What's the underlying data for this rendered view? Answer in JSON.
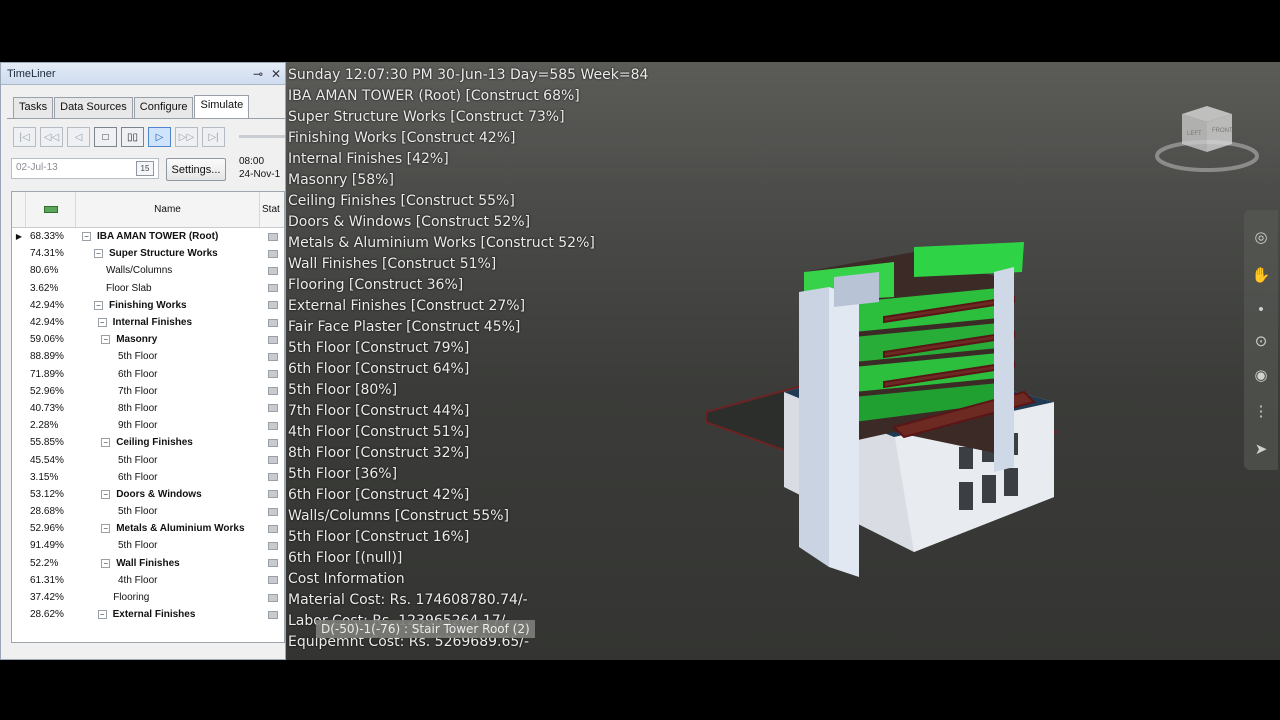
{
  "timeliner": {
    "title": "TimeLiner",
    "pin_icon": "pin-icon",
    "close_icon": "close-icon",
    "tabs": [
      "Tasks",
      "Data Sources",
      "Configure",
      "Simulate"
    ],
    "active_tab": "Simulate",
    "date_value": "02-Jul-13",
    "calendar_label": "15",
    "settings_label": "Settings...",
    "time_start": "08:00",
    "time_end": "24-Nov-1",
    "columns": {
      "name": "Name",
      "status": "Stat"
    },
    "rows": [
      {
        "pct": "68.33%",
        "name": "IBA AMAN TOWER (Root)",
        "bold": true,
        "toggle": "⊟",
        "level": 0,
        "current": true
      },
      {
        "pct": "74.31%",
        "name": "Super Structure Works",
        "bold": true,
        "toggle": "⊟",
        "level": 1
      },
      {
        "pct": "80.6%",
        "name": "Walls/Columns",
        "bold": false,
        "toggle": "",
        "level": 2
      },
      {
        "pct": "3.62%",
        "name": "Floor Slab",
        "bold": false,
        "toggle": "",
        "level": 2
      },
      {
        "pct": "42.94%",
        "name": "Finishing Works",
        "bold": true,
        "toggle": "⊟",
        "level": 1
      },
      {
        "pct": "42.94%",
        "name": "Internal Finishes",
        "bold": true,
        "toggle": "⊟",
        "level": 1.3
      },
      {
        "pct": "59.06%",
        "name": "Masonry",
        "bold": true,
        "toggle": "⊟",
        "level": 1.6
      },
      {
        "pct": "88.89%",
        "name": "5th Floor",
        "bold": false,
        "toggle": "",
        "level": 3
      },
      {
        "pct": "71.89%",
        "name": "6th Floor",
        "bold": false,
        "toggle": "",
        "level": 3
      },
      {
        "pct": "52.96%",
        "name": "7th Floor",
        "bold": false,
        "toggle": "",
        "level": 3
      },
      {
        "pct": "40.73%",
        "name": "8th Floor",
        "bold": false,
        "toggle": "",
        "level": 3
      },
      {
        "pct": "2.28%",
        "name": "9th Floor",
        "bold": false,
        "toggle": "",
        "level": 3
      },
      {
        "pct": "55.85%",
        "name": "Ceiling Finishes",
        "bold": true,
        "toggle": "⊟",
        "level": 1.6
      },
      {
        "pct": "45.54%",
        "name": "5th Floor",
        "bold": false,
        "toggle": "",
        "level": 3
      },
      {
        "pct": "3.15%",
        "name": "6th Floor",
        "bold": false,
        "toggle": "",
        "level": 3
      },
      {
        "pct": "53.12%",
        "name": "Doors & Windows",
        "bold": true,
        "toggle": "⊟",
        "level": 1.6
      },
      {
        "pct": "28.68%",
        "name": "5th Floor",
        "bold": false,
        "toggle": "",
        "level": 3
      },
      {
        "pct": "52.96%",
        "name": "Metals & Aluminium Works",
        "bold": true,
        "toggle": "⊟",
        "level": 1.6
      },
      {
        "pct": "91.49%",
        "name": "5th Floor",
        "bold": false,
        "toggle": "",
        "level": 3
      },
      {
        "pct": "52.2%",
        "name": "Wall Finishes",
        "bold": true,
        "toggle": "⊟",
        "level": 1.6
      },
      {
        "pct": "61.31%",
        "name": "4th Floor",
        "bold": false,
        "toggle": "",
        "level": 3
      },
      {
        "pct": "37.42%",
        "name": "Flooring",
        "bold": false,
        "toggle": "",
        "level": 2.6
      },
      {
        "pct": "28.62%",
        "name": "External Finishes",
        "bold": true,
        "toggle": "⊟",
        "level": 1.3
      }
    ]
  },
  "viewport": {
    "overlay_lines": [
      "Sunday 12:07:30 PM 30-Jun-13 Day=585 Week=84",
      "IBA AMAN TOWER (Root) [Construct 68%]",
      "Super Structure Works [Construct 73%]",
      "Finishing Works [Construct 42%]",
      "Internal Finishes [42%]",
      "Masonry [58%]",
      "Ceiling Finishes [Construct 55%]",
      "Doors & Windows [Construct 52%]",
      "Metals & Aluminium Works [Construct 52%]",
      "Wall Finishes [Construct 51%]",
      "Flooring [Construct 36%]",
      "External Finishes [Construct 27%]",
      "Fair Face Plaster [Construct 45%]",
      "5th Floor [Construct 79%]",
      "6th Floor [Construct 64%]",
      "5th Floor [80%]",
      "7th Floor [Construct 44%]",
      "4th Floor [Construct 51%]",
      "8th Floor [Construct 32%]",
      "5th Floor [36%]",
      "6th Floor [Construct 42%]",
      "Walls/Columns [Construct 55%]",
      "5th Floor [Construct 16%]",
      "6th Floor [(null)]",
      "Cost Information",
      "Material Cost: Rs. 174608780.74/-",
      "Labor Cost: Rs. 123965264.17/-",
      "Equipemnt Cost: Rs. 5269689.65/-"
    ],
    "tooltip": "D(-50)-1(-76) : Stair Tower Roof (2)",
    "viewcube_left": "LEFT",
    "viewcube_front": "FRONT",
    "nav_icons": [
      "steering-wheel-icon",
      "pan-icon",
      "zoom-icon",
      "orbit-icon",
      "look-icon",
      "walk-icon",
      "select-icon"
    ]
  },
  "colors": {
    "panel_bg": "#f0f0f0",
    "viewport_bg": "#4a4b48",
    "active_tab": "#ffffff",
    "construct_green": "#35d14a"
  }
}
